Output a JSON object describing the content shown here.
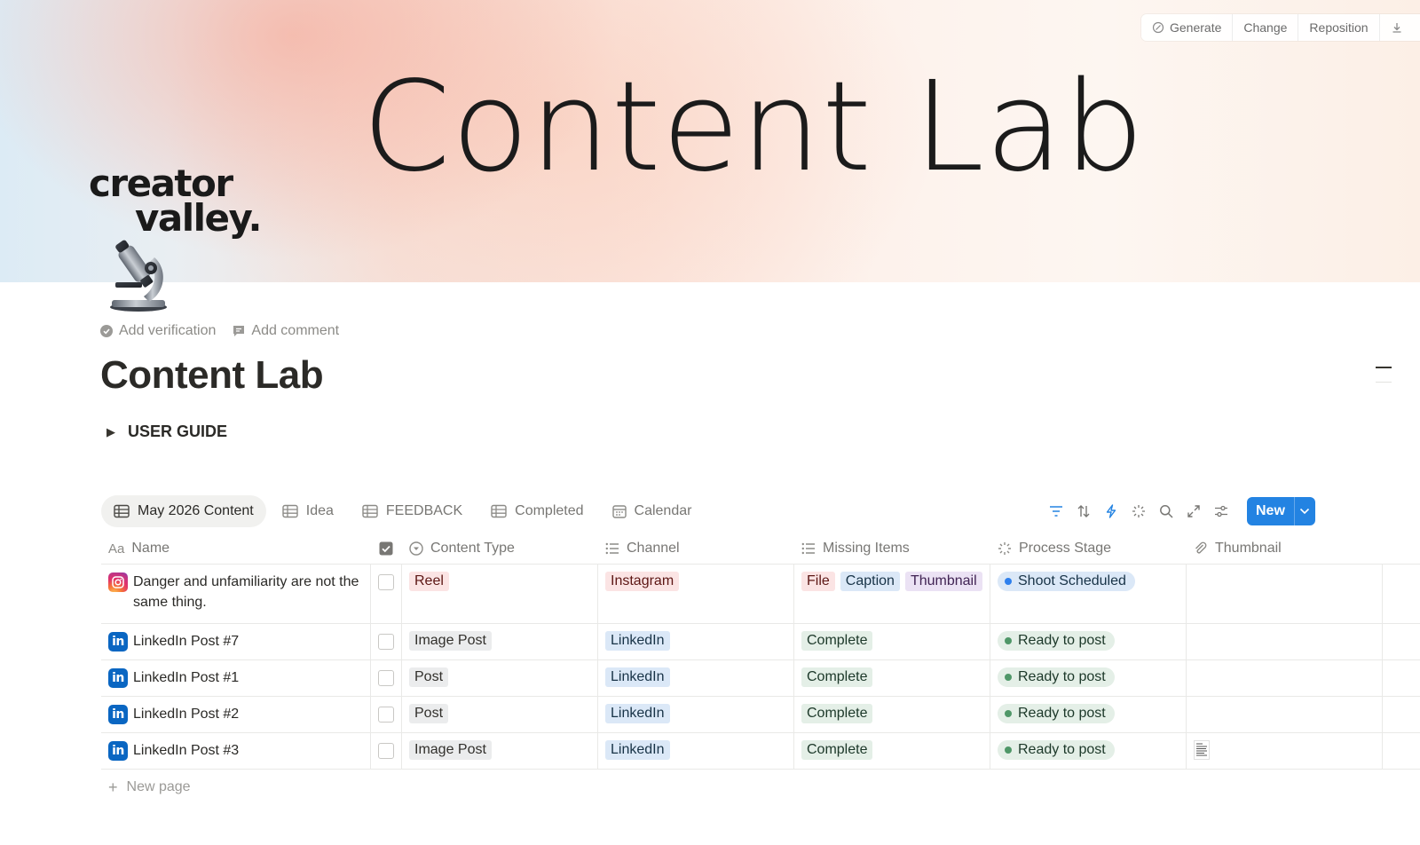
{
  "cover": {
    "title": "Content Lab",
    "brand_line1": "creator",
    "brand_line2": "valley.",
    "controls": [
      "Generate",
      "Change",
      "Reposition"
    ]
  },
  "page": {
    "icon": "microscope-icon",
    "actions": {
      "verification": "Add verification",
      "comment": "Add comment"
    },
    "title": "Content Lab",
    "toggle_label": "USER GUIDE"
  },
  "views": [
    {
      "label": "May 2026 Content",
      "icon": "table-icon",
      "active": true
    },
    {
      "label": "Idea",
      "icon": "table-icon",
      "active": false
    },
    {
      "label": "FEEDBACK",
      "icon": "table-icon",
      "active": false
    },
    {
      "label": "Completed",
      "icon": "table-icon",
      "active": false
    },
    {
      "label": "Calendar",
      "icon": "calendar-icon",
      "active": false
    }
  ],
  "toolbar": {
    "tools": [
      "filter-icon",
      "sort-icon",
      "automation-icon",
      "ai-icon",
      "search-icon",
      "expand-icon",
      "settings-icon"
    ],
    "new_label": "New"
  },
  "columns": [
    {
      "label": "Name",
      "icon": "text-icon"
    },
    {
      "label": "",
      "icon": "checkbox-icon"
    },
    {
      "label": "Content Type",
      "icon": "select-icon"
    },
    {
      "label": "Channel",
      "icon": "list-icon"
    },
    {
      "label": "Missing Items",
      "icon": "list-icon"
    },
    {
      "label": "Process Stage",
      "icon": "status-icon"
    },
    {
      "label": "Thumbnail",
      "icon": "attachment-icon"
    }
  ],
  "rows": [
    {
      "name": "Danger and unfamiliarity are not the same thing.",
      "platform": "instagram",
      "type": "Reel",
      "channel": "Instagram",
      "missing": [
        "File",
        "Caption",
        "Thumbnail"
      ],
      "stage": "Shoot Scheduled",
      "thumbnail": false
    },
    {
      "name": "LinkedIn Post #7",
      "platform": "linkedin",
      "type": "Image Post",
      "channel": "LinkedIn",
      "missing": [
        "Complete"
      ],
      "stage": "Ready to post",
      "thumbnail": false
    },
    {
      "name": "LinkedIn Post #1",
      "platform": "linkedin",
      "type": "Post",
      "channel": "LinkedIn",
      "missing": [
        "Complete"
      ],
      "stage": "Ready to post",
      "thumbnail": false
    },
    {
      "name": "LinkedIn Post #2",
      "platform": "linkedin",
      "type": "Post",
      "channel": "LinkedIn",
      "missing": [
        "Complete"
      ],
      "stage": "Ready to post",
      "thumbnail": false
    },
    {
      "name": "LinkedIn Post #3",
      "platform": "linkedin",
      "type": "Image Post",
      "channel": "LinkedIn",
      "missing": [
        "Complete"
      ],
      "stage": "Ready to post",
      "thumbnail": true
    }
  ],
  "new_page_label": "New page",
  "colors": {
    "accent": "#2383e2",
    "linkedin": "#0a66c2",
    "status_blue": "#2f80ed",
    "status_green": "#4f9768"
  }
}
